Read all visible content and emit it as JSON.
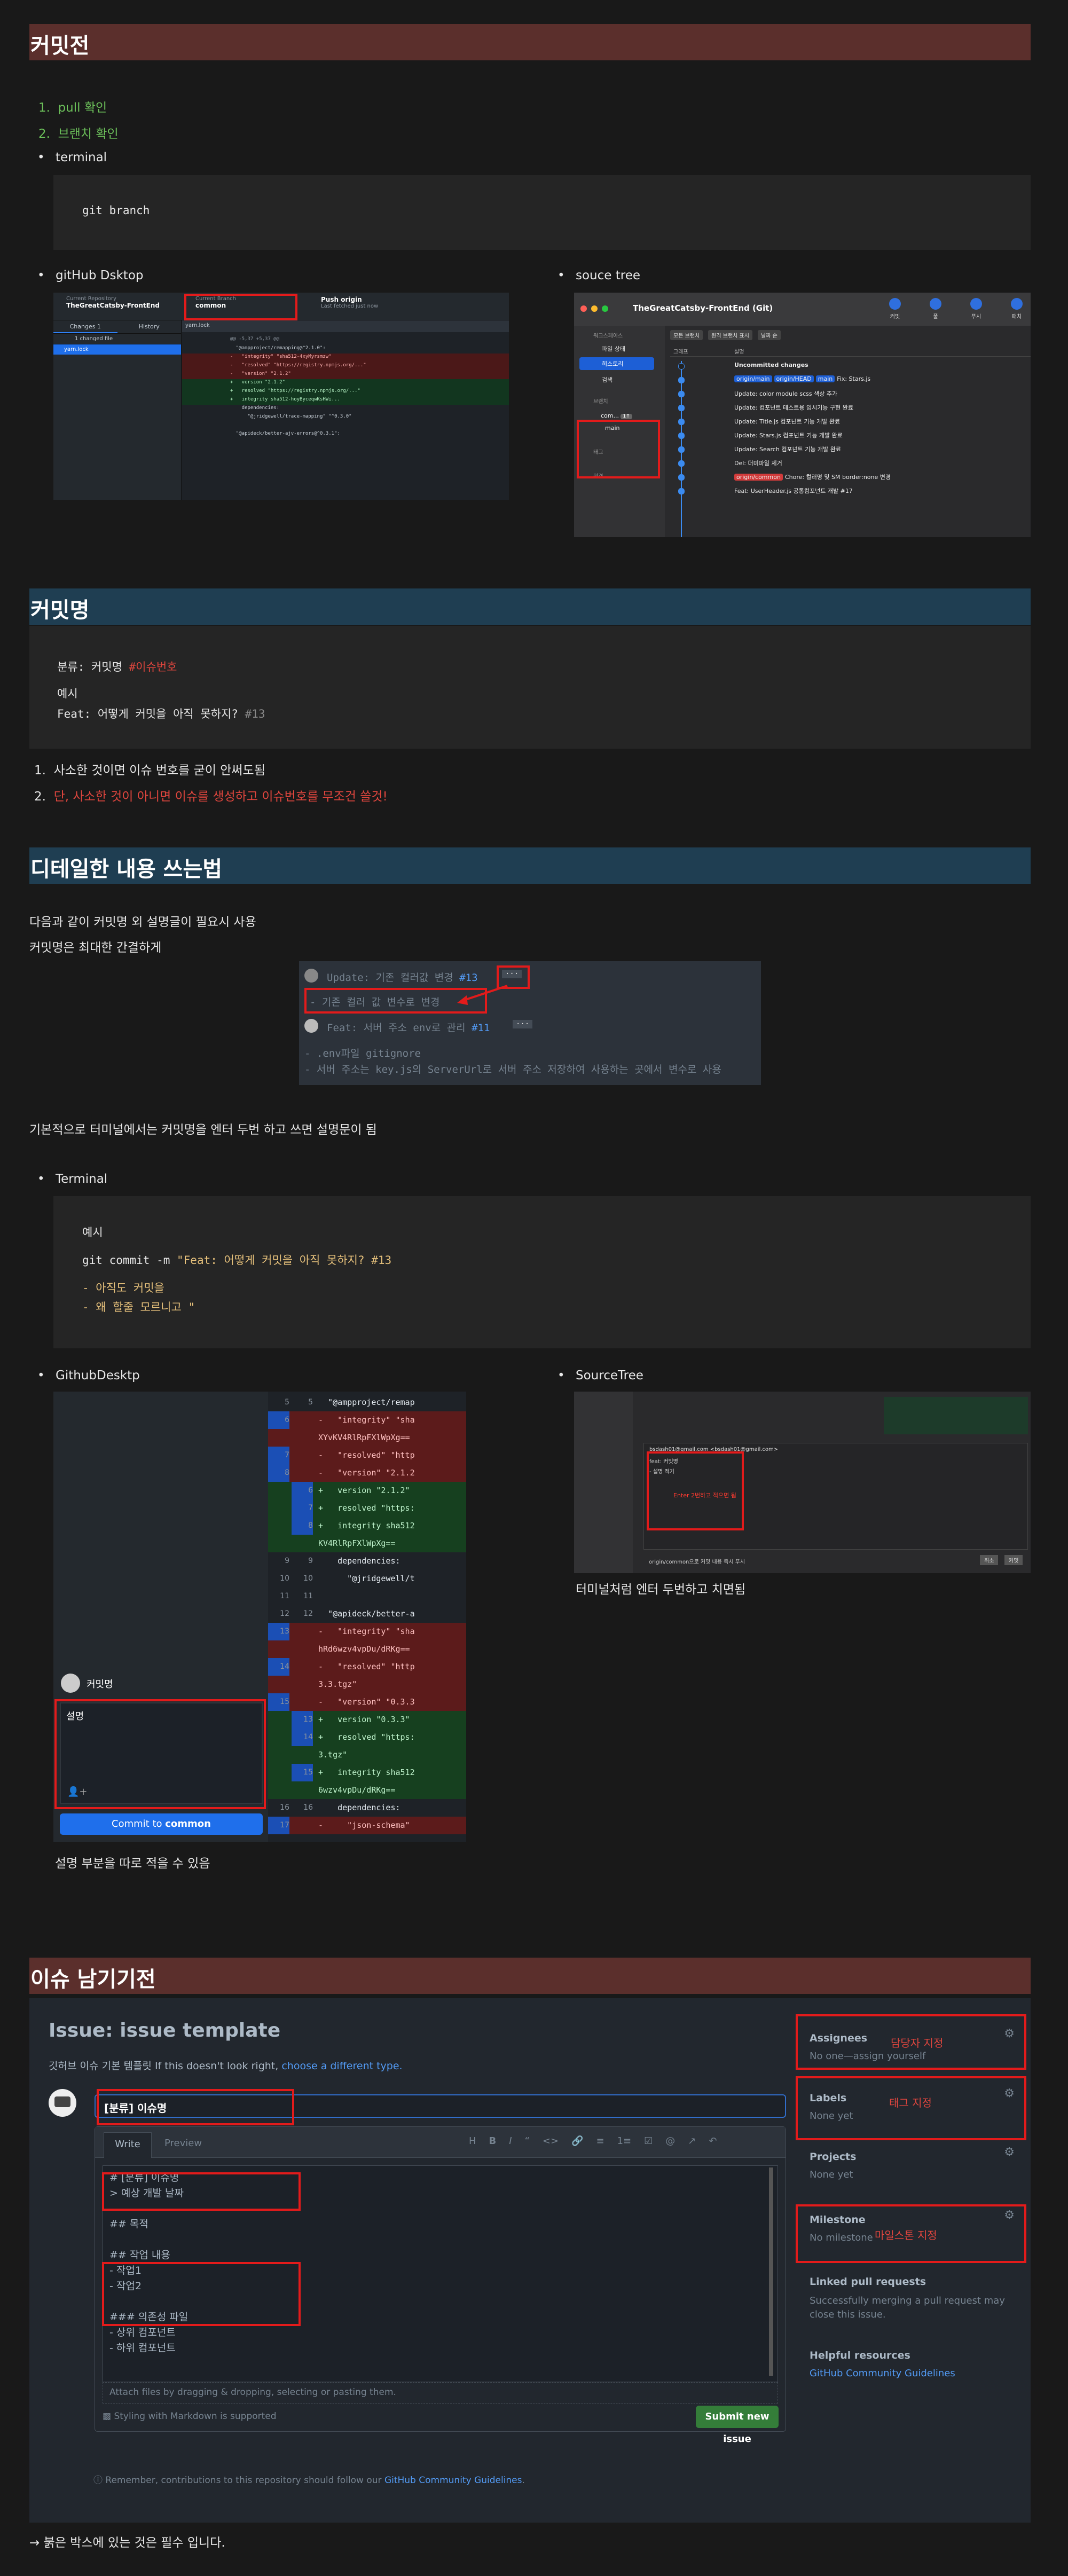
{
  "sections": {
    "commit_s": "커밋전",
    "commit_name": "커밋명",
    "detail": "디테일한 내용 쓰는법",
    "issue": "이슈 남기기전"
  },
  "commit_before": {
    "steps": [
      "pull 확인",
      "브랜치 확인"
    ],
    "terminal_label": "terminal",
    "git_branch_cmd": "git branch",
    "github_desktop_label": "gitHub Dsktop",
    "sourcetree_label": "souce tree"
  },
  "ghd1": {
    "repo_label": "Current Repository",
    "repo_value": "TheGreatCatsby-FrontEnd",
    "branch_label": "Current Branch",
    "branch_value": "common",
    "push_label": "Push origin",
    "push_sub": "Last fetched just now",
    "tab_changes": "Changes 1",
    "tab_history": "History",
    "changed_count": "1 changed file",
    "file": "yarn.lock",
    "diff_hunk": "@@ -5,37 +5,37 @@",
    "diff_lines": [
      {
        "t": "ctx",
        "s": "  \"@ampproject/remapping@^2.1.0\":"
      },
      {
        "t": "del",
        "s": "-   \"integrity\" \"sha512-4xyMyrsmzw\""
      },
      {
        "t": "del",
        "s": "-   \"resolved\" \"https://registry.npmjs.org/...\""
      },
      {
        "t": "del",
        "s": "-   \"version\" \"2.1.2\""
      },
      {
        "t": "add",
        "s": "+   version \"2.1.2\""
      },
      {
        "t": "add",
        "s": "+   resolved \"https://registry.npmjs.org/...\""
      },
      {
        "t": "add",
        "s": "+   integrity sha512-hoyByceqwKsHWi..."
      },
      {
        "t": "ctx",
        "s": "    dependencies:"
      },
      {
        "t": "ctx",
        "s": "      \"@jridgewell/trace-mapping\" \"^0.3.0\""
      },
      {
        "t": "ctx",
        "s": ""
      },
      {
        "t": "ctx",
        "s": "  \"@apideck/better-ajv-errors@^0.3.1\":"
      }
    ]
  },
  "st1": {
    "title": "TheGreatCatsby-FrontEnd (Git)",
    "toolbar": [
      "커밋",
      "풀",
      "푸시",
      "패치"
    ],
    "side_group": "워크스페이스",
    "side_items": [
      "파일 상태",
      "히스토리",
      "검색"
    ],
    "branch_group": "브랜치",
    "branches": [
      "com...",
      "main"
    ],
    "branch_badge": "1↑",
    "tags": "태그",
    "remote": "원격",
    "filters": [
      "모든 브랜치",
      "원격 브랜치 표시",
      "날짜 순"
    ],
    "col_graph": "그래프",
    "col_desc": "설명",
    "commits": [
      "Uncommitted changes",
      "Fix: Stars.js",
      "Update: color module scss 색상 추가",
      "Update: 컴포넌트 테스트용 임시기능 구현 완료",
      "Update: Title.js 컴포넌트 기능 개발 완료",
      "Update: Stars.js 컴포넌트 기능 개발 완료",
      "Update: Search 컴포넌트 기능 개발 완료",
      "Del: 더미파일 제거",
      "Chore: 컬러명 및 SM border:none 변경",
      "Feat: UserHeader.js 공통컴포넌트 개발 #17"
    ],
    "tags_row": [
      "origin/main",
      "origin/HEAD",
      "main"
    ],
    "tag_common": "origin/common"
  },
  "commit_name": {
    "format_prefix": "분류: 커밋명 ",
    "format_issue": "#이슈번호",
    "example_label": "예시",
    "example_prefix": "Feat: 어떻게 커밋을 아직 못하지? ",
    "example_issue": "#13",
    "rules": [
      "사소한 것이면 이슈 번호를 굳이 안써도됨",
      "단, 사소한 것이 아니면 이슈를 생성하고 이슈번호를 무조건 쓸것!"
    ]
  },
  "detail": {
    "line1": "다음과 같이 커밋명 외 설명글이 필요시 사용",
    "line2": "커밋명은 최대한 간결하게",
    "sample_title1": "Update: 기존 컬러값 변경 ",
    "sample_issue1": "#13",
    "sample_body1": "- 기존 컬러 값 변수로 변경",
    "sample_title2": "Feat: 서버 주소 env로 관리 ",
    "sample_issue2": "#11",
    "sample_body2a": "- .env파일 gitignore",
    "sample_body2b": "- 서버 주소는 key.js의 ServerUrl로 서버 주소 저장하여 사용하는 곳에서 변수로 사용",
    "more": "···",
    "enter_tip": "기본적으로 터미널에서는 커밋명을 엔터 두번 하고 쓰면 설명문이 됨",
    "terminal_label": "Terminal",
    "example_label": "예시",
    "cmd_prefix": "git commit -m ",
    "cmd_msg": "\"Feat: 어떻게 커밋을 아직 못하지? #13",
    "cmd_body1": "- 아직도 커밋을",
    "cmd_body2": "- 왜 할줄 모르니고 \"",
    "ghd_label": "GithubDesktp",
    "st_label": "SourceTree",
    "ghd_caption": "설명 부분을 따로 적을 수 있음",
    "st_caption": "터미널처럼 엔터 두번하고 치면됨"
  },
  "ghd2": {
    "summary": "커밋명",
    "description": "설명",
    "commit_btn_prefix": "Commit to ",
    "commit_btn_branch": "common",
    "lines": [
      {
        "o": "5",
        "n": "5",
        "t": "ctx",
        "s": "  \"@ampproject/remap"
      },
      {
        "o": "6",
        "n": "",
        "t": "del",
        "s": "-   \"integrity\" \"sha"
      },
      {
        "o": "",
        "n": "",
        "t": "del",
        "s": "XYvKV4RlRpFXlWpXg=="
      },
      {
        "o": "7",
        "n": "",
        "t": "del",
        "s": "-   \"resolved\" \"http"
      },
      {
        "o": "8",
        "n": "",
        "t": "del",
        "s": "-   \"version\" \"2.1.2"
      },
      {
        "o": "",
        "n": "6",
        "t": "add",
        "s": "+   version \"2.1.2\""
      },
      {
        "o": "",
        "n": "7",
        "t": "add",
        "s": "+   resolved \"https:"
      },
      {
        "o": "",
        "n": "8",
        "t": "add",
        "s": "+   integrity sha512"
      },
      {
        "o": "",
        "n": "",
        "t": "add",
        "s": "KV4RlRpFXlWpXg=="
      },
      {
        "o": "9",
        "n": "9",
        "t": "ctx",
        "s": "    dependencies:"
      },
      {
        "o": "10",
        "n": "10",
        "t": "ctx",
        "s": "      \"@jridgewell/t"
      },
      {
        "o": "11",
        "n": "11",
        "t": "ctx",
        "s": ""
      },
      {
        "o": "12",
        "n": "12",
        "t": "ctx",
        "s": "  \"@apideck/better-a"
      },
      {
        "o": "13",
        "n": "",
        "t": "del",
        "s": "-   \"integrity\" \"sha"
      },
      {
        "o": "",
        "n": "",
        "t": "del",
        "s": "hRd6wzv4vpDu/dRKg=="
      },
      {
        "o": "14",
        "n": "",
        "t": "del",
        "s": "-   \"resolved\" \"http"
      },
      {
        "o": "",
        "n": "",
        "t": "del",
        "s": "3.3.tgz\""
      },
      {
        "o": "15",
        "n": "",
        "t": "del",
        "s": "-   \"version\" \"0.3.3"
      },
      {
        "o": "",
        "n": "13",
        "t": "add",
        "s": "+   version \"0.3.3\""
      },
      {
        "o": "",
        "n": "14",
        "t": "add",
        "s": "+   resolved \"https:"
      },
      {
        "o": "",
        "n": "",
        "t": "add",
        "s": "3.tgz\""
      },
      {
        "o": "",
        "n": "15",
        "t": "add",
        "s": "+   integrity sha512"
      },
      {
        "o": "",
        "n": "",
        "t": "add",
        "s": "6wzv4vpDu/dRKg=="
      },
      {
        "o": "16",
        "n": "16",
        "t": "ctx",
        "s": "    dependencies:"
      },
      {
        "o": "17",
        "n": "",
        "t": "del",
        "s": "-     \"json-schema\""
      }
    ]
  },
  "st2": {
    "author": "bsdash01@gmail.com <bsdash01@gmail.com>",
    "line1": "feat: 커밋명",
    "line2": "- 설명 적기",
    "note": "Enter 2번하고 적으면 됨",
    "footer_branch": "origin/common으로 커밋 내용 즉시 푸시",
    "btn1": "취소",
    "btn2": "커밋"
  },
  "issue": {
    "title": "Issue: issue template",
    "subtitle_prefix": "깃허브 이슈 기본 템플릿 If this doesn't look right, ",
    "subtitle_link": "choose a different type.",
    "title_input": "[분류] 이슈명",
    "tab_write": "Write",
    "tab_preview": "Preview",
    "body_lines": [
      "# [분류] 이슈명",
      "> 예상 개발 날짜",
      "",
      "## 목적",
      "",
      "## 작업 내용",
      "- 작업1",
      "- 작업2",
      "",
      "### 의존성 파일",
      "- 상위 컴포넌트",
      "- 하위 컴포넌트"
    ],
    "attach_hint": "Attach files by dragging & dropping, selecting or pasting them.",
    "markdown_note": "Styling with Markdown is supported",
    "submit": "Submit new issue",
    "remember_prefix": "Remember, contributions to this repository should follow our ",
    "remember_link": "GitHub Community Guidelines",
    "remember_suffix": ".",
    "assignees_title": "Assignees",
    "assignees_value": "No one—assign yourself",
    "assignees_note": "담당자 지정",
    "labels_title": "Labels",
    "labels_value": "None yet",
    "labels_note": "태그 지정",
    "projects_title": "Projects",
    "projects_value": "None yet",
    "milestone_title": "Milestone",
    "milestone_value": "No milestone",
    "milestone_note": "마일스톤 지정",
    "linked_title": "Linked pull requests",
    "linked_value": "Successfully merging a pull request may close this issue.",
    "helpful_title": "Helpful resources",
    "helpful_link": "GitHub Community Guidelines",
    "footer_note": "→ 붉은 박스에 있는 것은 필수 입니다."
  }
}
